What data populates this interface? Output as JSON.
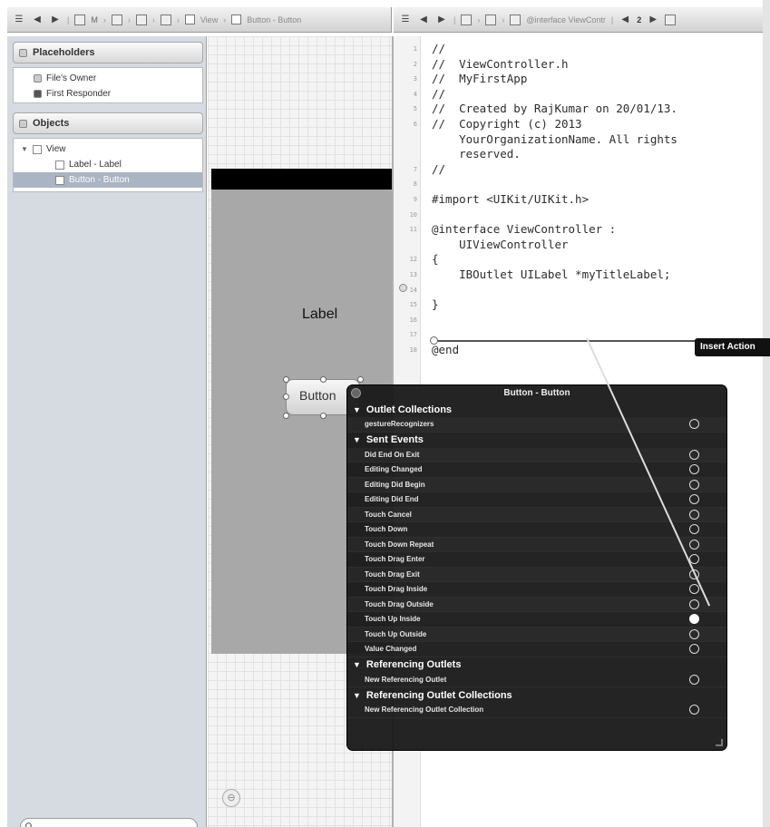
{
  "left_jumpbar": {
    "crumbs": [
      "M",
      "View",
      "Button - Button"
    ]
  },
  "right_jumpbar": {
    "crumb": "@interface ViewContr",
    "counter": "2"
  },
  "outline": {
    "placeholders_title": "Placeholders",
    "placeholders": [
      "File's Owner",
      "First Responder"
    ],
    "objects_title": "Objects",
    "view_label": "View",
    "children": [
      "Label - Label",
      "Button - Button"
    ]
  },
  "canvas": {
    "label_text": "Label",
    "button_text": "Button"
  },
  "code_lines": [
    {
      "n": "1",
      "text": "//"
    },
    {
      "n": "2",
      "text": "//  ViewController.h"
    },
    {
      "n": "3",
      "text": "//  MyFirstApp"
    },
    {
      "n": "4",
      "text": "//"
    },
    {
      "n": "5",
      "text": "//  Created by RajKumar on 20/01/13."
    },
    {
      "n": "6",
      "text": "//  Copyright (c) 2013"
    },
    {
      "n": "",
      "text": "    YourOrganizationName. All rights"
    },
    {
      "n": "",
      "text": "    reserved."
    },
    {
      "n": "7",
      "text": "//"
    },
    {
      "n": "8",
      "text": ""
    },
    {
      "n": "9",
      "text": "#import <UIKit/UIKit.h>"
    },
    {
      "n": "10",
      "text": ""
    },
    {
      "n": "11",
      "text": "@interface ViewController :"
    },
    {
      "n": "",
      "text": "    UIViewController"
    },
    {
      "n": "12",
      "text": "{"
    },
    {
      "n": "13",
      "text": "    IBOutlet UILabel *myTitleLabel;"
    },
    {
      "n": "14",
      "text": ""
    },
    {
      "n": "15",
      "text": "}"
    },
    {
      "n": "16",
      "text": ""
    },
    {
      "n": "17",
      "text": ""
    },
    {
      "n": "18",
      "text": "@end"
    }
  ],
  "insert_tooltip": "Insert Action",
  "hud": {
    "title": "Button - Button",
    "sections": [
      {
        "title": "Outlet Collections",
        "items": [
          "gestureRecognizers"
        ]
      },
      {
        "title": "Sent Events",
        "items": [
          "Did End On Exit",
          "Editing Changed",
          "Editing Did Begin",
          "Editing Did End",
          "Touch Cancel",
          "Touch Down",
          "Touch Down Repeat",
          "Touch Drag Enter",
          "Touch Drag Exit",
          "Touch Drag Inside",
          "Touch Drag Outside",
          "Touch Up Inside",
          "Touch Up Outside",
          "Value Changed"
        ],
        "active": "Touch Up Inside"
      },
      {
        "title": "Referencing Outlets",
        "items": [
          "New Referencing Outlet"
        ]
      },
      {
        "title": "Referencing Outlet Collections",
        "items": [
          "New Referencing Outlet Collection"
        ]
      }
    ]
  }
}
